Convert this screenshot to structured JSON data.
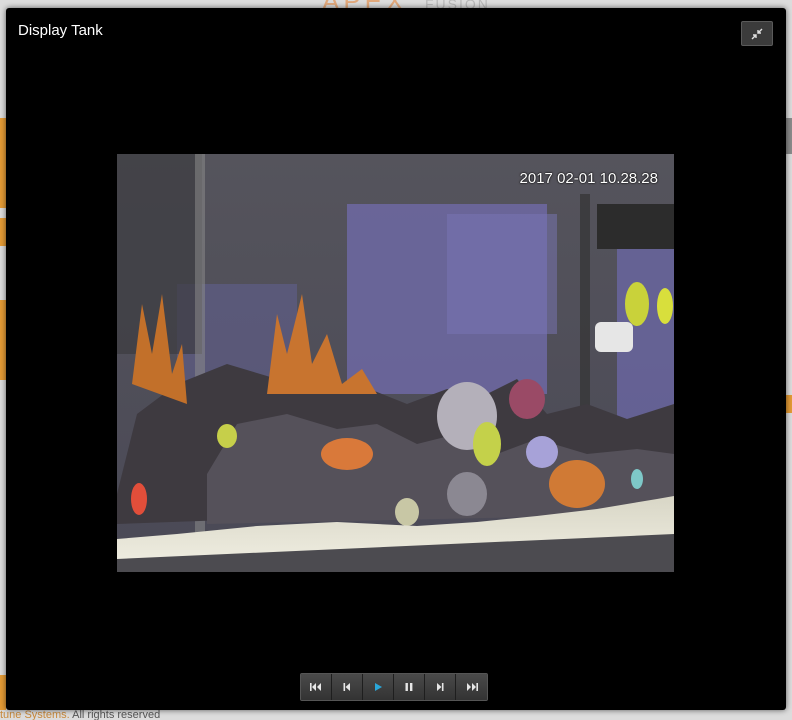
{
  "background": {
    "logo_text": "APEX",
    "logo_sub": "FUSION",
    "footer_company": "tune Systems.",
    "footer_rights": " All rights reserved"
  },
  "modal": {
    "title": "Display Tank",
    "collapse_icon": "compress-icon"
  },
  "camera": {
    "timestamp": "2017 02-01 10.28.28"
  },
  "controls": [
    {
      "name": "skip-to-start-button",
      "icon": "skip-start-icon"
    },
    {
      "name": "step-back-button",
      "icon": "step-back-icon"
    },
    {
      "name": "play-button",
      "icon": "play-icon",
      "active_color": "#2aa6d8"
    },
    {
      "name": "pause-button",
      "icon": "pause-icon"
    },
    {
      "name": "step-forward-button",
      "icon": "step-forward-icon"
    },
    {
      "name": "skip-to-end-button",
      "icon": "skip-end-icon"
    }
  ],
  "colors": {
    "accent_orange": "#e39a35",
    "play_blue": "#2aa6d8"
  }
}
